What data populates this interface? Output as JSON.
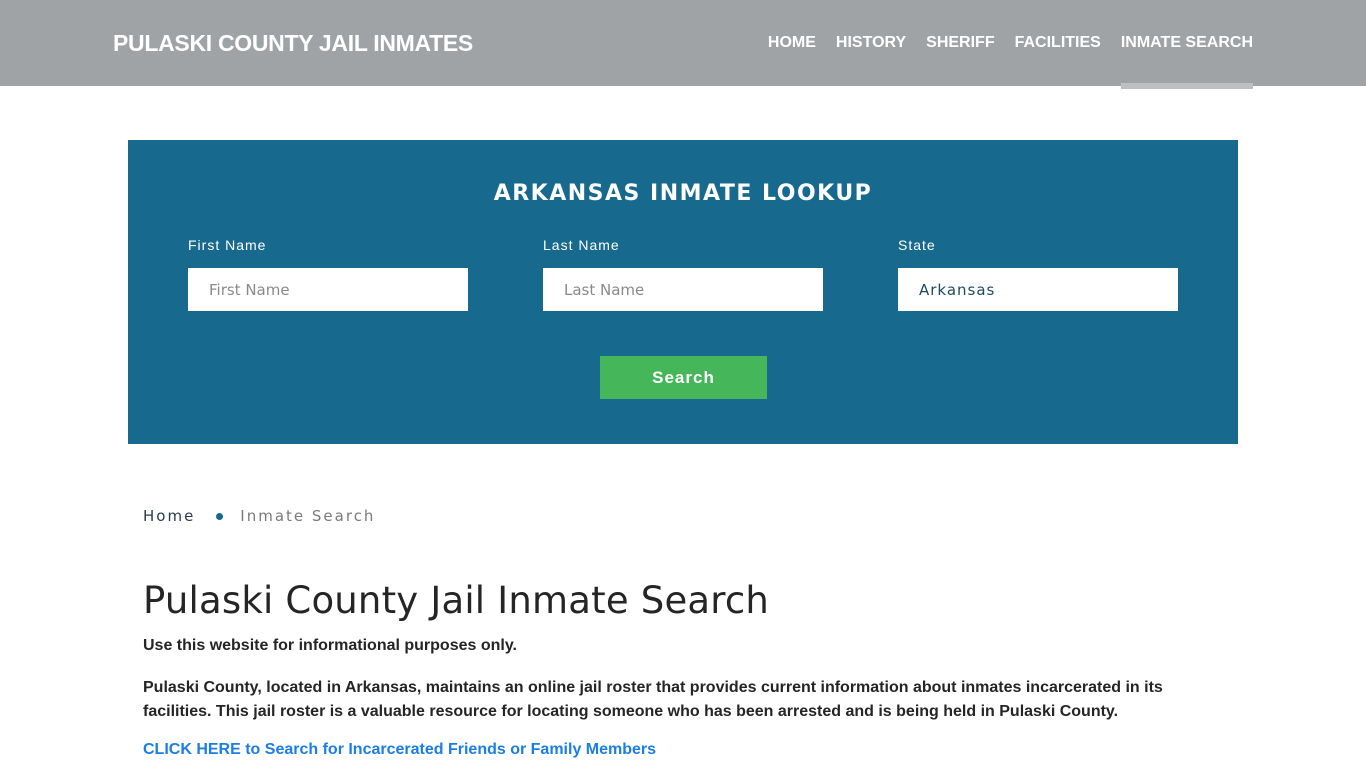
{
  "header": {
    "brand": "PULASKI COUNTY JAIL INMATES",
    "nav": [
      {
        "label": "HOME",
        "active": false
      },
      {
        "label": "HISTORY",
        "active": false
      },
      {
        "label": "SHERIFF",
        "active": false
      },
      {
        "label": "FACILITIES",
        "active": false
      },
      {
        "label": "INMATE SEARCH",
        "active": true
      }
    ]
  },
  "lookup": {
    "title": "ARKANSAS INMATE LOOKUP",
    "first_name": {
      "label": "First Name",
      "placeholder": "First Name",
      "value": ""
    },
    "last_name": {
      "label": "Last Name",
      "placeholder": "Last Name",
      "value": ""
    },
    "state": {
      "label": "State",
      "value": "Arkansas"
    },
    "search_label": "Search"
  },
  "breadcrumb": {
    "home": "Home",
    "current": "Inmate Search"
  },
  "content": {
    "title": "Pulaski County Jail Inmate Search",
    "intro": "Use this website for informational purposes only.",
    "paragraph": "Pulaski County, located in Arkansas, maintains an online jail roster that provides current information about inmates incarcerated in its facilities. This jail roster is a valuable resource for locating someone who has been arrested and is being held in Pulaski County.",
    "cta": "CLICK HERE to Search for Incarcerated Friends or Family Members"
  },
  "colors": {
    "header_bg": "#9fa3a6",
    "panel_bg": "#176a8e",
    "button_bg": "#45b75a",
    "link": "#1a7ee6"
  }
}
